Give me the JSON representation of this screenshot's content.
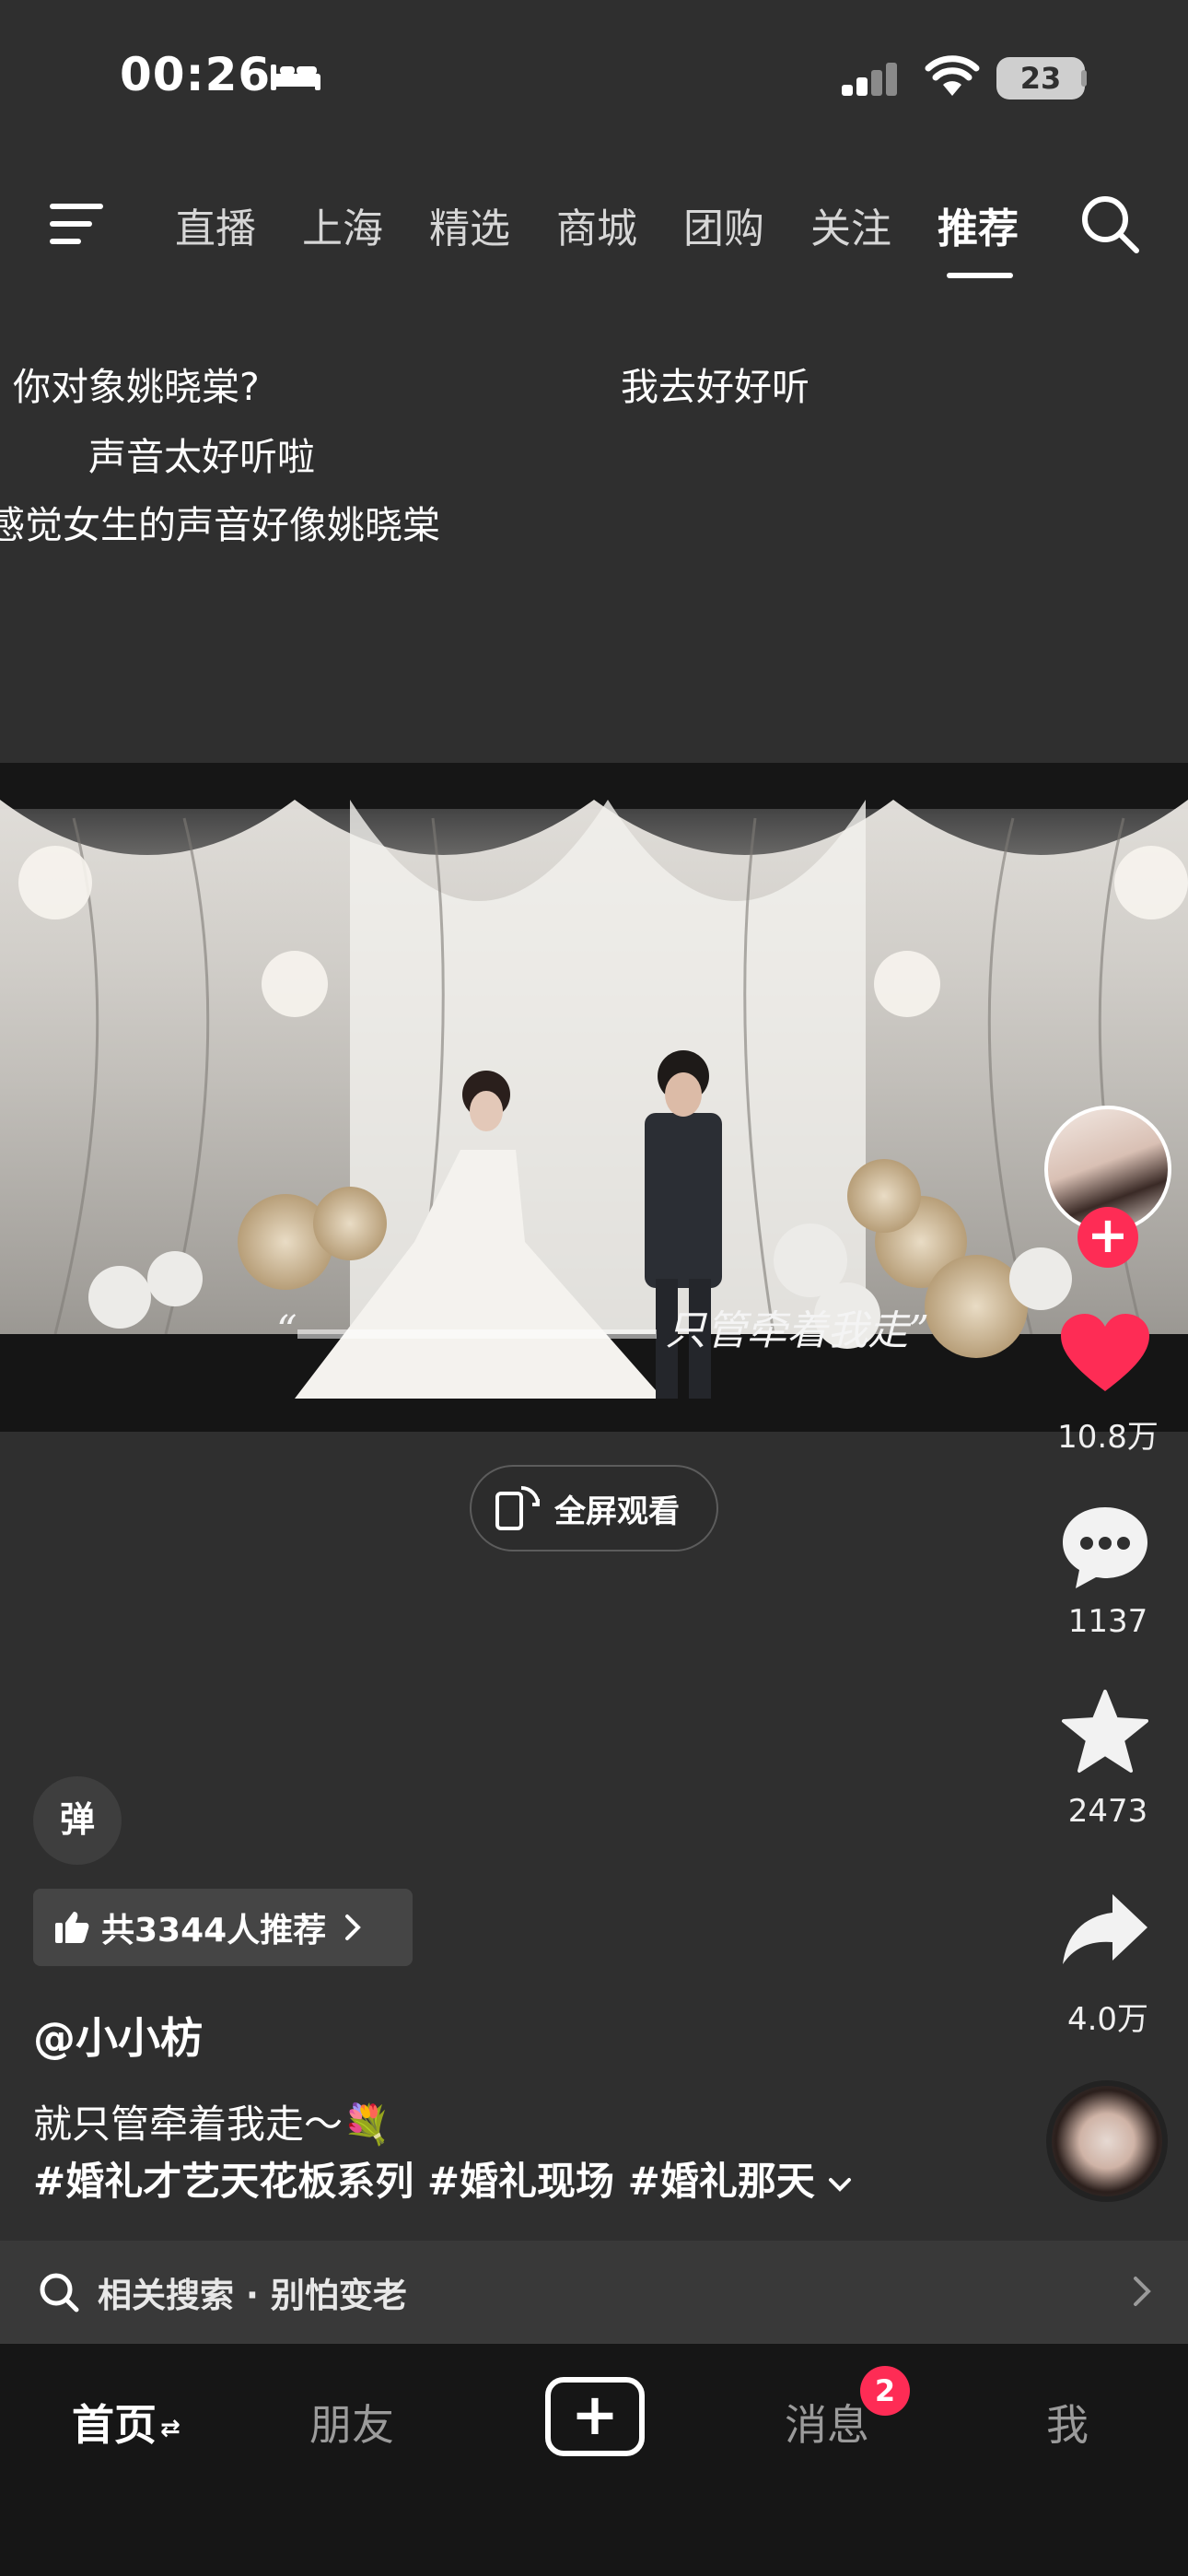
{
  "status_bar": {
    "time": "00:26",
    "battery": "23"
  },
  "top_nav": {
    "menu_icon": "hamburger-menu",
    "tabs": [
      {
        "label": "直播"
      },
      {
        "label": "上海"
      },
      {
        "label": "精选"
      },
      {
        "label": "商城"
      },
      {
        "label": "团购"
      },
      {
        "label": "关注"
      },
      {
        "label": "推荐",
        "active": true
      }
    ],
    "search_icon": "search"
  },
  "danmaku": [
    "你对象姚晓棠?",
    "我去好好听",
    "声音太好听啦",
    "感觉女生的声音好像姚晓棠"
  ],
  "video": {
    "subtitle": "只管牵着我走”",
    "subtitle_open_quote": "“"
  },
  "fullscreen": {
    "label": "全屏观看"
  },
  "right_rail": {
    "likes": "10.8万",
    "comments": "1137",
    "favorites": "2473",
    "shares": "4.0万"
  },
  "info": {
    "danmu_toggle": "弹",
    "recommend": "共3344人推荐",
    "author": "@小小枋",
    "caption": "就只管牵着我走～💐",
    "hashtags": "#婚礼才艺天花板系列 #婚礼现场 #婚礼那天"
  },
  "related_search": {
    "label": "相关搜索 · 别怕变老"
  },
  "bottom_nav": {
    "home": "首页",
    "home_suffix": "⇄",
    "friends": "朋友",
    "create": "+",
    "messages": "消息",
    "messages_badge": "2",
    "me": "我"
  },
  "colors": {
    "background": "#2f2f2f",
    "accent": "#fe2c55",
    "bottom_nav_bg": "#161616"
  }
}
